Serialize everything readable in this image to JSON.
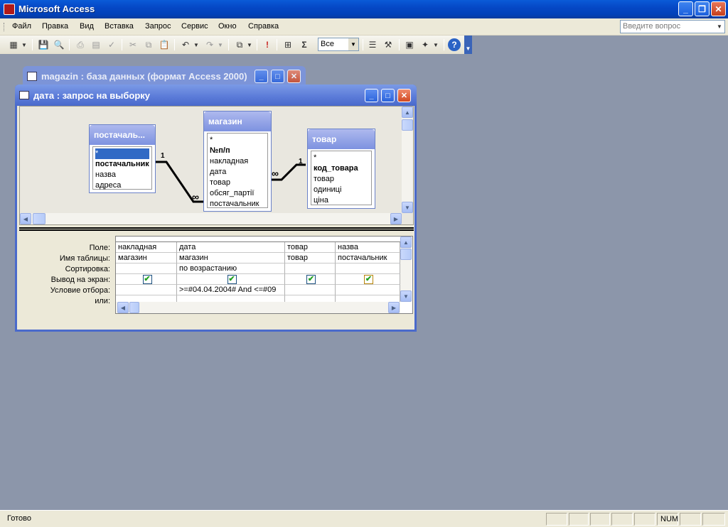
{
  "app": {
    "title": "Microsoft Access",
    "ask_placeholder": "Введите вопрос"
  },
  "menu": [
    "Файл",
    "Правка",
    "Вид",
    "Вставка",
    "Запрос",
    "Сервис",
    "Окно",
    "Справка"
  ],
  "toolbar": {
    "filter_value": "Все"
  },
  "db_window": {
    "title": "magazin : база данных (формат Access 2000)"
  },
  "query_window": {
    "title": "дата : запрос на выборку",
    "tables": [
      {
        "name": "постачаль...",
        "fields": [
          "*",
          "постачальник",
          "назва",
          "адреса"
        ]
      },
      {
        "name": "магазин",
        "fields": [
          "*",
          "№п/п",
          "накладная",
          "дата",
          "товар",
          "обсяг_партії",
          "постачальник"
        ]
      },
      {
        "name": "товар",
        "fields": [
          "*",
          "код_товара",
          "товар",
          "одиниці",
          "ціна"
        ]
      }
    ],
    "relations": [
      {
        "one": "1",
        "many": "∞"
      },
      {
        "one": "1",
        "many": "∞"
      }
    ],
    "grid_labels": [
      "Поле:",
      "Имя таблицы:",
      "Сортировка:",
      "Вывод на экран:",
      "Условие отбора:",
      "или:"
    ],
    "grid_columns": [
      {
        "field": "накладная",
        "table": "магазин",
        "sort": "",
        "show": true,
        "criteria": ""
      },
      {
        "field": "дата",
        "table": "магазин",
        "sort": "по возрастанию",
        "show": true,
        "criteria": ">=#04.04.2004# And <=#09"
      },
      {
        "field": "товар",
        "table": "товар",
        "sort": "",
        "show": true,
        "criteria": ""
      },
      {
        "field": "назва",
        "table": "постачальник",
        "sort": "",
        "show": true,
        "criteria": ""
      }
    ]
  },
  "status": {
    "text": "Готово",
    "num": "NUM"
  }
}
